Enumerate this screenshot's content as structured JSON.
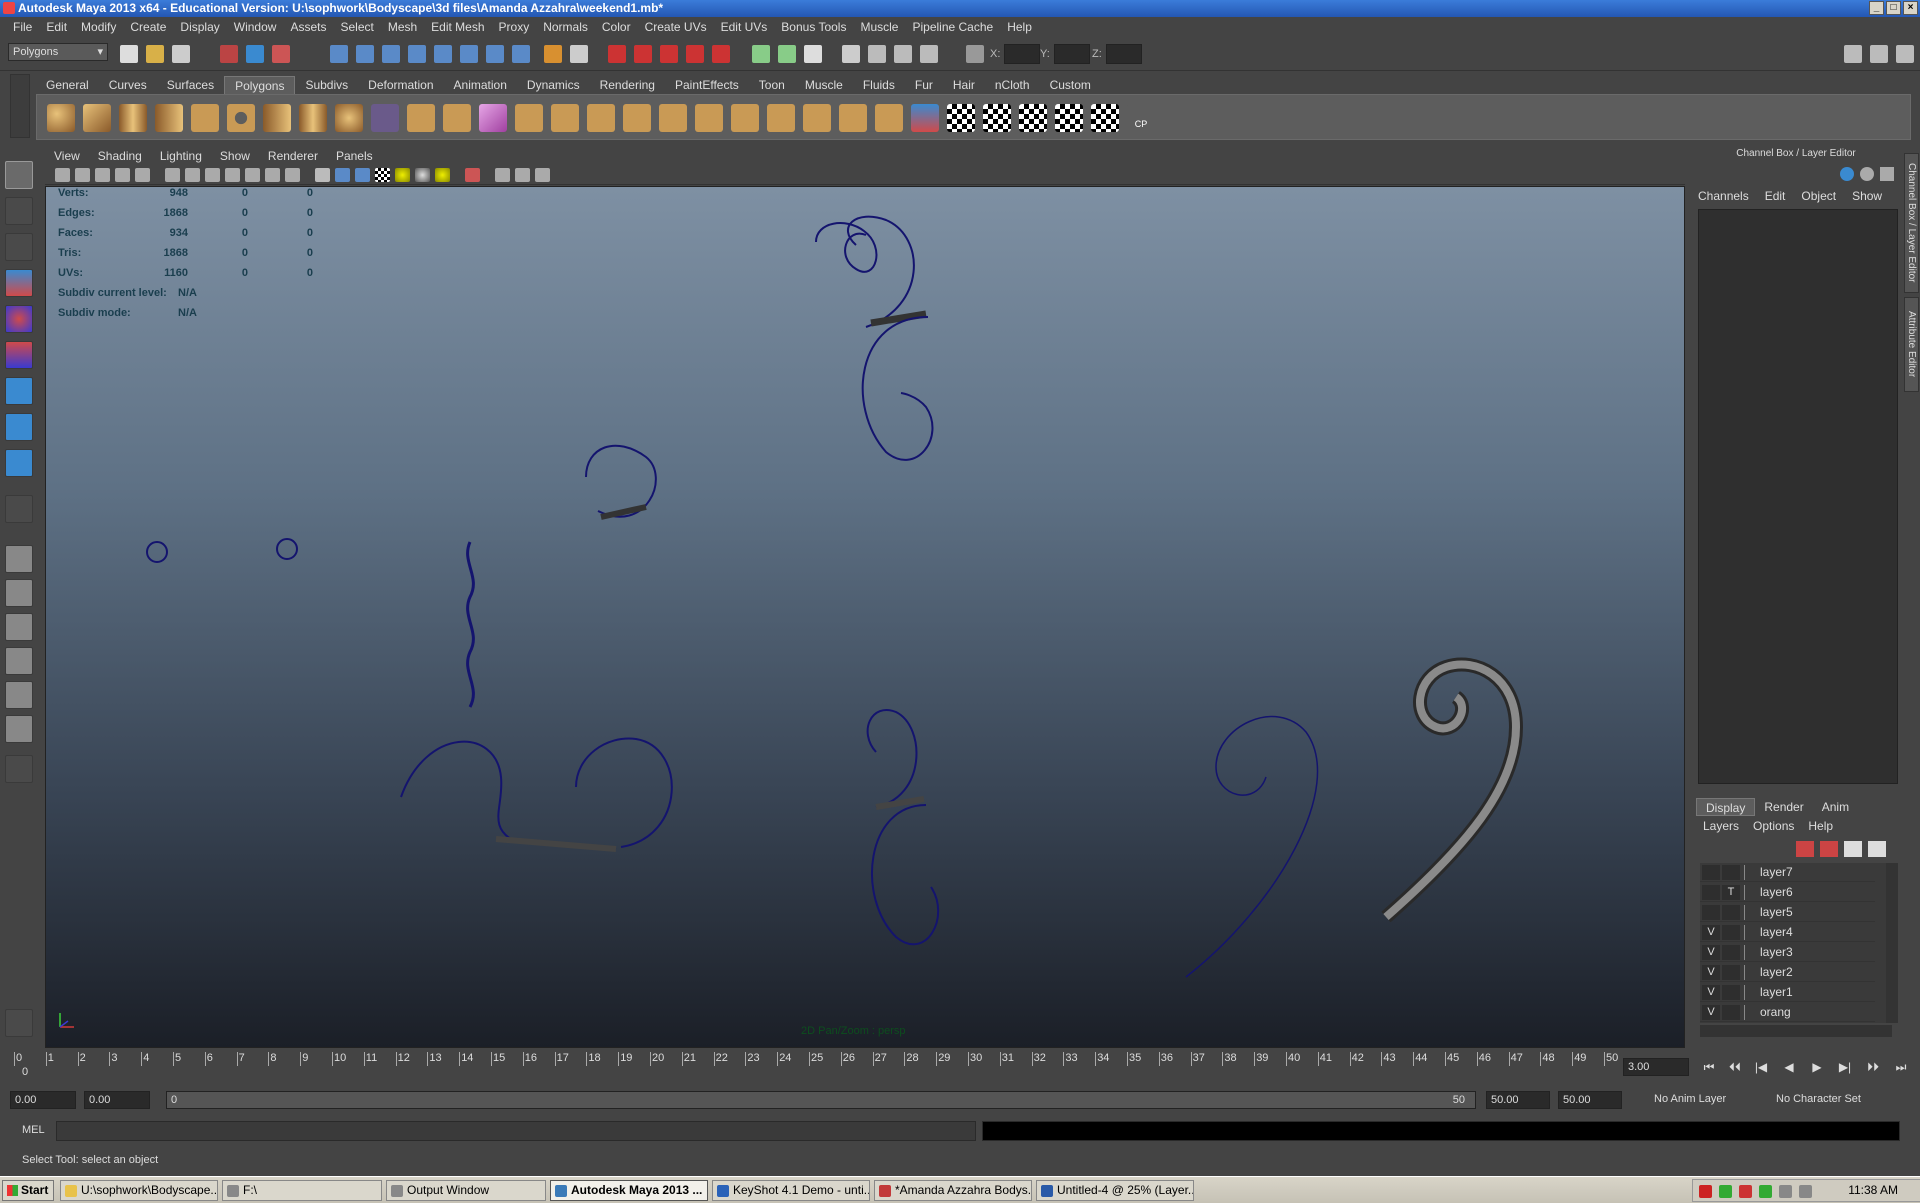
{
  "window": {
    "title": "Autodesk Maya 2013 x64 - Educational Version: U:\\sophwork\\Bodyscape\\3d files\\Amanda Azzahra\\weekend1.mb*"
  },
  "menubar": [
    "File",
    "Edit",
    "Modify",
    "Create",
    "Display",
    "Window",
    "Assets",
    "Select",
    "Mesh",
    "Edit Mesh",
    "Proxy",
    "Normals",
    "Color",
    "Create UVs",
    "Edit UVs",
    "Bonus Tools",
    "Muscle",
    "Pipeline Cache",
    "Help"
  ],
  "statusline": {
    "mode": "Polygons",
    "x_label": "X:",
    "y_label": "Y:",
    "z_label": "Z:"
  },
  "shelf_tabs": [
    "General",
    "Curves",
    "Surfaces",
    "Polygons",
    "Subdivs",
    "Deformation",
    "Animation",
    "Dynamics",
    "Rendering",
    "PaintEffects",
    "Toon",
    "Muscle",
    "Fluids",
    "Fur",
    "Hair",
    "nCloth",
    "Custom"
  ],
  "shelf_active": "Polygons",
  "shelf_cp_label": "CP",
  "viewport": {
    "menu": [
      "View",
      "Shading",
      "Lighting",
      "Show",
      "Renderer",
      "Panels"
    ],
    "camera_label": "2D Pan/Zoom : persp",
    "hud": [
      {
        "label": "Verts:",
        "v1": "948",
        "v2": "0",
        "v3": "0"
      },
      {
        "label": "Edges:",
        "v1": "1868",
        "v2": "0",
        "v3": "0"
      },
      {
        "label": "Faces:",
        "v1": "934",
        "v2": "0",
        "v3": "0"
      },
      {
        "label": "Tris:",
        "v1": "1868",
        "v2": "0",
        "v3": "0"
      },
      {
        "label": "UVs:",
        "v1": "1160",
        "v2": "0",
        "v3": "0"
      },
      {
        "label": "Subdiv current level:",
        "v1": "N/A",
        "v2": "",
        "v3": ""
      },
      {
        "label": "Subdiv mode:",
        "v1": "N/A",
        "v2": "",
        "v3": ""
      }
    ]
  },
  "channel_box": {
    "title": "Channel Box / Layer Editor",
    "menu": [
      "Channels",
      "Edit",
      "Object",
      "Show"
    ],
    "side_tabs": [
      "Channel Box / Layer Editor",
      "Attribute Editor"
    ]
  },
  "layer_editor": {
    "tabs": [
      "Display",
      "Render",
      "Anim"
    ],
    "active_tab": "Display",
    "menu": [
      "Layers",
      "Options",
      "Help"
    ],
    "layers": [
      {
        "name": "layer7",
        "v": "",
        "t": ""
      },
      {
        "name": "layer6",
        "v": "",
        "t": "T"
      },
      {
        "name": "layer5",
        "v": "",
        "t": ""
      },
      {
        "name": "layer4",
        "v": "V",
        "t": ""
      },
      {
        "name": "layer3",
        "v": "V",
        "t": ""
      },
      {
        "name": "layer2",
        "v": "V",
        "t": ""
      },
      {
        "name": "layer1",
        "v": "V",
        "t": ""
      },
      {
        "name": "orang",
        "v": "V",
        "t": ""
      }
    ]
  },
  "timeslider": {
    "ticks": [
      "0",
      "1",
      "2",
      "3",
      "4",
      "5",
      "6",
      "7",
      "8",
      "9",
      "10",
      "11",
      "12",
      "13",
      "14",
      "15",
      "16",
      "17",
      "18",
      "19",
      "20",
      "21",
      "22",
      "23",
      "24",
      "25",
      "26",
      "27",
      "28",
      "29",
      "30",
      "31",
      "32",
      "33",
      "34",
      "35",
      "36",
      "37",
      "38",
      "39",
      "40",
      "41",
      "42",
      "43",
      "44",
      "45",
      "46",
      "47",
      "48",
      "49",
      "50"
    ],
    "current_marker": "0",
    "current_time": "3.00"
  },
  "playback": {
    "buttons": [
      "⏮",
      "⏴⏴",
      "|◀",
      "◀",
      "▶",
      "▶|",
      "⏵⏵",
      "⏭"
    ]
  },
  "range": {
    "start": "0.00",
    "playback_start": "0.00",
    "slider_start": "0",
    "slider_end": "50",
    "playback_end": "50.00",
    "end": "50.00",
    "anim_layer": "No Anim Layer",
    "character_set": "No Character Set"
  },
  "command": {
    "label": "MEL"
  },
  "help_line": "Select Tool: select an object",
  "taskbar": {
    "start": "Start",
    "tasks": [
      {
        "label": "U:\\sophwork\\Bodyscape...",
        "color": "#e8c24a"
      },
      {
        "label": "F:\\",
        "color": "#888"
      },
      {
        "label": "Output Window",
        "color": "#888"
      },
      {
        "label": "Autodesk Maya 2013 ...",
        "color": "#3a7ab8"
      },
      {
        "label": "KeyShot 4.1 Demo  - unti...",
        "color": "#2a62b8"
      },
      {
        "label": "*Amanda Azzahra Bodys...",
        "color": "#c23a3a"
      },
      {
        "label": "Untitled-4 @ 25% (Layer...",
        "color": "#2a5aa8"
      }
    ],
    "clock": "11:38 AM"
  }
}
